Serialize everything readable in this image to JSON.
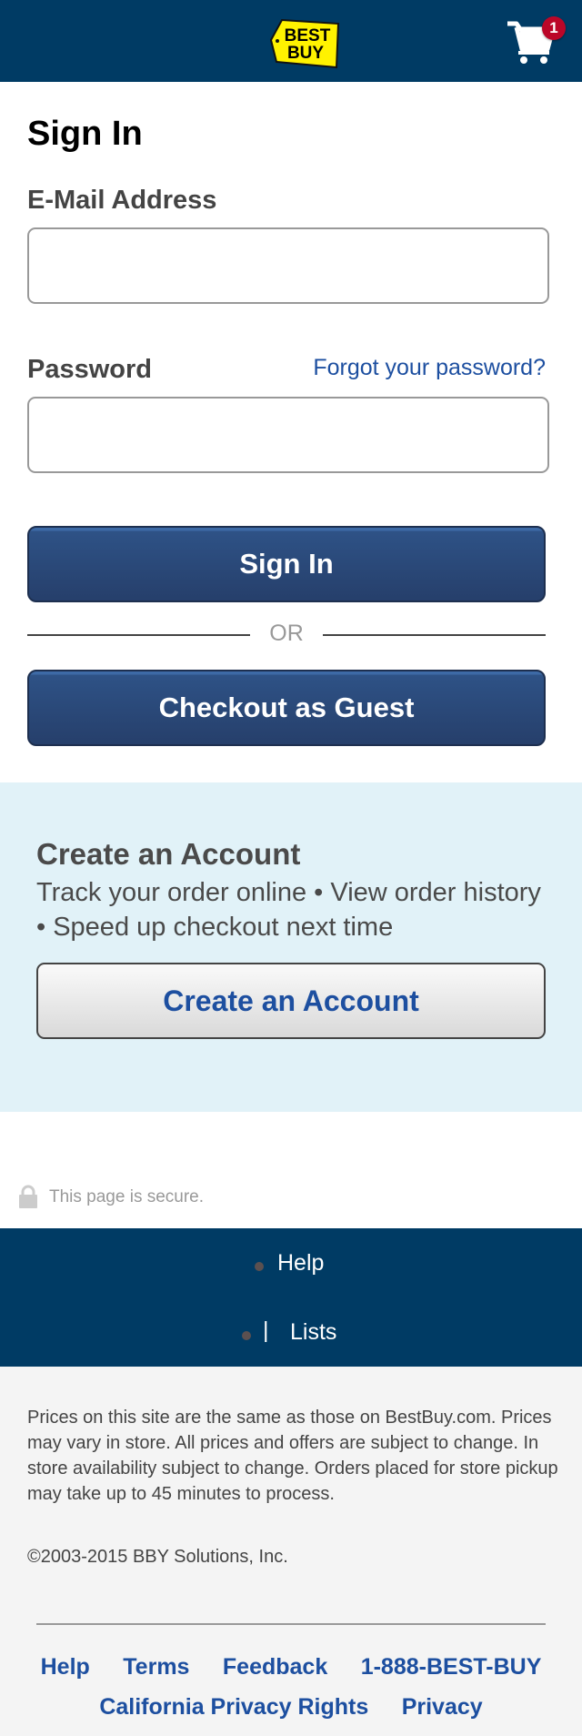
{
  "header": {
    "logo_alt": "Best Buy",
    "logo_line1": "BEST",
    "logo_line2": "BUY",
    "cart_count": "1"
  },
  "signin": {
    "title": "Sign In",
    "email_label": "E-Mail Address",
    "email_value": "",
    "password_label": "Password",
    "password_value": "",
    "forgot_link": "Forgot your password?",
    "signin_button": "Sign In",
    "or_text": "OR",
    "guest_button": "Checkout as Guest"
  },
  "create_account": {
    "title": "Create an Account",
    "description": "Track your order online • View order history  • Speed up checkout next time",
    "button": "Create an Account"
  },
  "secure": {
    "text": "This page is secure."
  },
  "nav_footer": {
    "items": [
      "Help",
      "Lists"
    ],
    "separator": "|"
  },
  "legal": {
    "disclaimer": "Prices on this site are the same as those on BestBuy.com. Prices may vary in store. All prices and offers are subject to change. In store availability subject to change. Orders placed for store pickup may take up to 45 minutes to process.",
    "copyright": "©2003-2015 BBY Solutions, Inc.",
    "links_row1": [
      "Help",
      "Terms",
      "Feedback",
      "1-888-BEST-BUY"
    ],
    "links_row2": [
      "California Privacy Rights",
      "Privacy"
    ]
  },
  "colors": {
    "header_bg": "#003b64",
    "brand_yellow": "#fff200",
    "link_blue": "#1d4fa0",
    "badge_red": "#bb0628",
    "create_bg": "#e1f2f8"
  }
}
